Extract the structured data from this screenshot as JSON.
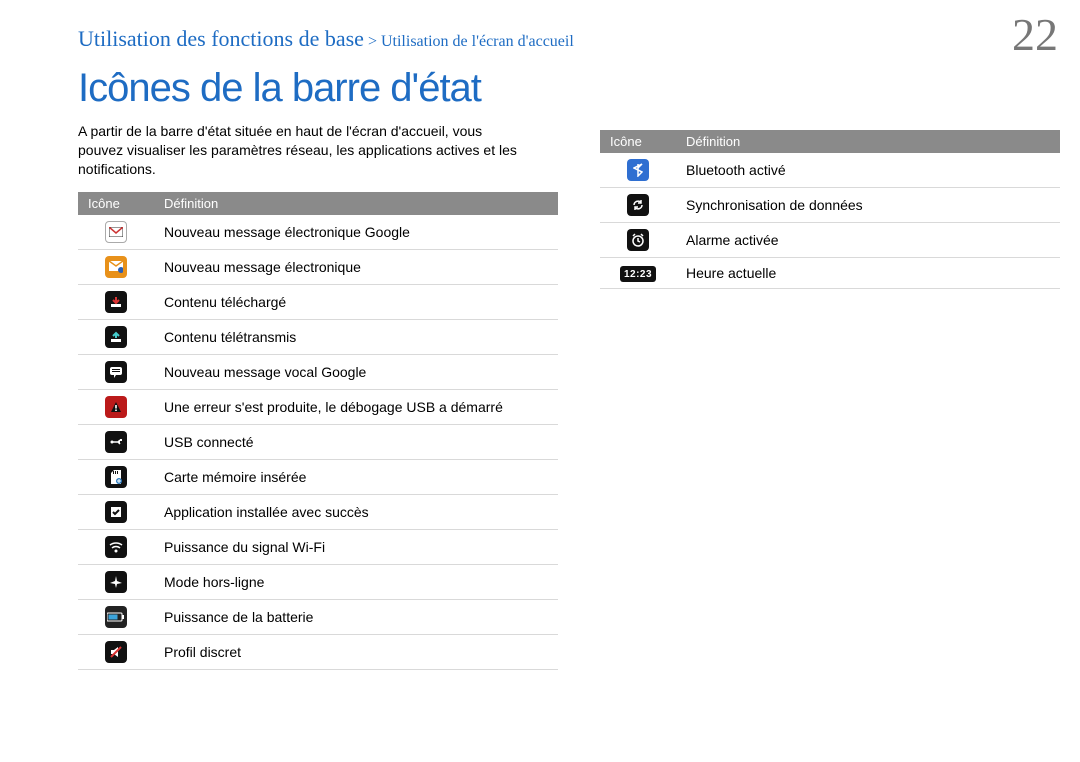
{
  "breadcrumb": {
    "section": "Utilisation des fonctions de base",
    "separator": " > ",
    "subsection": "Utilisation de l'écran d'accueil"
  },
  "page_number": "22",
  "title": "Icônes de la barre d'état",
  "intro": "A partir de la barre d'état située en haut de l'écran d'accueil, vous pouvez visualiser les paramètres réseau, les applications actives et les notifications.",
  "table_headers": {
    "icon": "Icône",
    "definition": "Définition"
  },
  "left_rows": [
    {
      "icon": "gmail-icon",
      "def": "Nouveau message électronique Google"
    },
    {
      "icon": "email-icon",
      "def": "Nouveau message électronique"
    },
    {
      "icon": "download-icon",
      "def": "Contenu téléchargé"
    },
    {
      "icon": "upload-icon",
      "def": "Contenu télétransmis"
    },
    {
      "icon": "voice-msg-icon",
      "def": "Nouveau message vocal Google"
    },
    {
      "icon": "error-icon",
      "def": "Une erreur s'est produite, le débogage USB a démarré"
    },
    {
      "icon": "usb-icon",
      "def": "USB connecté"
    },
    {
      "icon": "sdcard-icon",
      "def": "Carte mémoire insérée"
    },
    {
      "icon": "installed-icon",
      "def": "Application installée avec succès"
    },
    {
      "icon": "wifi-icon",
      "def": "Puissance du signal Wi-Fi"
    },
    {
      "icon": "airplane-icon",
      "def": "Mode hors-ligne"
    },
    {
      "icon": "battery-icon",
      "def": "Puissance de la batterie"
    },
    {
      "icon": "silent-icon",
      "def": "Profil discret"
    }
  ],
  "right_rows": [
    {
      "icon": "bluetooth-icon",
      "def": "Bluetooth activé"
    },
    {
      "icon": "sync-icon",
      "def": "Synchronisation de données"
    },
    {
      "icon": "alarm-icon",
      "def": "Alarme activée"
    },
    {
      "icon": "clock-icon",
      "def": "Heure actuelle",
      "time_label": "12:23"
    }
  ]
}
